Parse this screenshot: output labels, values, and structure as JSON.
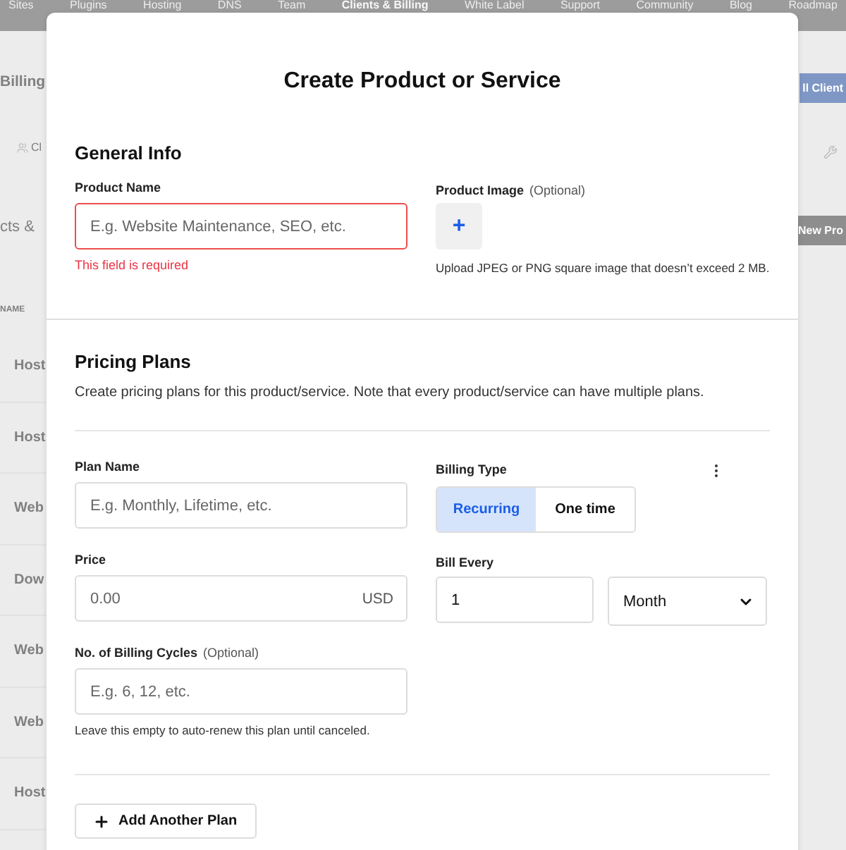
{
  "background": {
    "nav": [
      {
        "label": "Sites",
        "selected": false
      },
      {
        "label": "Plugins",
        "selected": false
      },
      {
        "label": "Hosting",
        "selected": false
      },
      {
        "label": "DNS",
        "selected": false
      },
      {
        "label": "Team",
        "selected": false
      },
      {
        "label": "Clients & Billing",
        "selected": true
      },
      {
        "label": "White Label",
        "selected": false
      },
      {
        "label": "Support",
        "selected": false
      },
      {
        "label": "Community",
        "selected": false
      },
      {
        "label": "Blog",
        "selected": false
      },
      {
        "label": "Roadmap",
        "selected": false
      }
    ],
    "page_title": "Billing",
    "tab": "Cl",
    "section_title": "cts &",
    "column_header": "NAME",
    "rows": [
      "Host",
      "Host",
      "Web",
      "Dow",
      "Web",
      "Web",
      "Host"
    ],
    "add_client_button": "ll Client",
    "new_product_button": "New Pro"
  },
  "modal": {
    "title": "Create Product or Service",
    "general_info": {
      "heading": "General Info",
      "product_name": {
        "label": "Product Name",
        "placeholder": "E.g. Website Maintenance, SEO, etc.",
        "invalid": true,
        "error": "This field is required"
      },
      "product_image": {
        "label": "Product Image",
        "optional": "(Optional)",
        "button": "+",
        "hint": "Upload JPEG or PNG square image that doesn’t exceed 2 MB."
      }
    },
    "pricing_plans": {
      "heading": "Pricing Plans",
      "description": "Create pricing plans for this product/service. Note that every product/service can have multiple plans.",
      "plans": [
        {
          "plan_name": {
            "label": "Plan Name",
            "placeholder": "E.g. Monthly, Lifetime, etc."
          },
          "billing_type": {
            "label": "Billing Type",
            "options": [
              {
                "label": "Recurring",
                "selected": true
              },
              {
                "label": "One time",
                "selected": false
              }
            ]
          },
          "price": {
            "label": "Price",
            "placeholder": "0.00",
            "suffix": "USD"
          },
          "bill_every": {
            "label": "Bill Every",
            "value": "1",
            "unit": "Month"
          },
          "billing_cycles": {
            "label": "No. of Billing Cycles",
            "optional": "(Optional)",
            "placeholder": "E.g. 6, 12, etc.",
            "hint": "Leave this empty to auto-renew this plan until canceled."
          }
        }
      ],
      "add_button": "Add Another Plan"
    }
  }
}
